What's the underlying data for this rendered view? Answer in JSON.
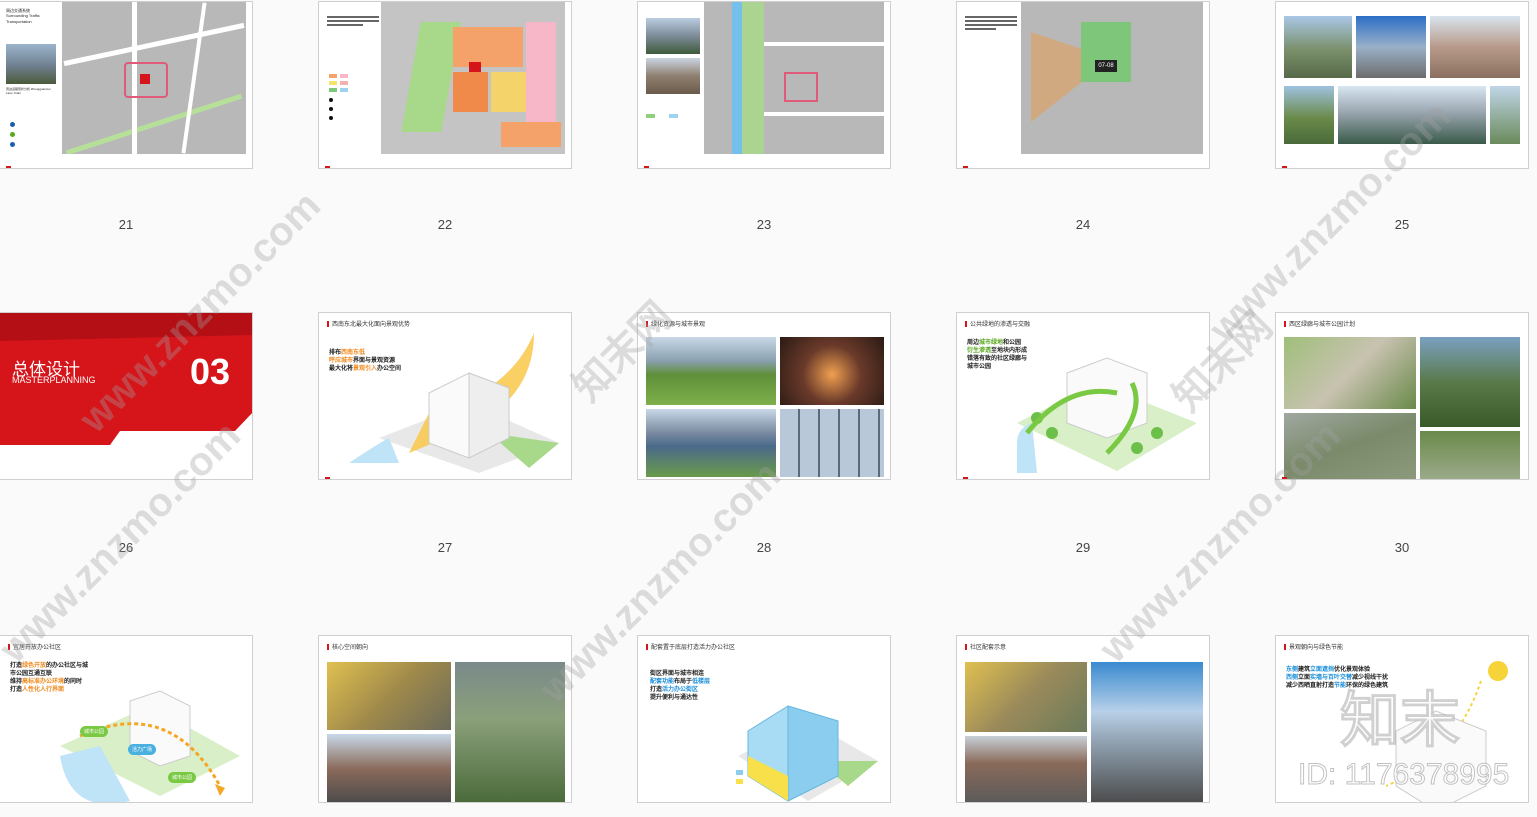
{
  "slides": [
    {
      "num": "21"
    },
    {
      "num": "22"
    },
    {
      "num": "23"
    },
    {
      "num": "24"
    },
    {
      "num": "25"
    },
    {
      "num": "26",
      "cn_title": "总体设计",
      "en_title": "MASTERPLANNING",
      "section": "03"
    },
    {
      "num": "27",
      "title": "西南东北最大化面向景观优势",
      "l1a": "排布",
      "l1b": "西南东低",
      "l2a": "",
      "l2b": "呼应城市",
      "l2c": "界面与景观资源",
      "l3a": "最大化将",
      "l3b": "景观引入",
      "l3c": "办公空间"
    },
    {
      "num": "28",
      "title": "绿化资源与城市景观"
    },
    {
      "num": "29",
      "title": "公共绿地的渗透与交融",
      "l1a": "周边",
      "l1b": "城市绿地",
      "l1c": "和公园",
      "l2a": "衍生渗透",
      "l2b": "至地块内形成",
      "l3": "错落有致的社区绿廊与",
      "l4": "城市公园"
    },
    {
      "num": "30",
      "title": "西区绿廊与城市公园计划"
    },
    {
      "num": "",
      "title": "宜居开放办公社区",
      "l1a": "打造",
      "l1b": "绿色开放",
      "l1c": "的办公社区与城",
      "l2": "市公园互通互联",
      "l3a": "维持",
      "l3b": "高标准办公环境",
      "l3c": "的同时",
      "l4a": "打造",
      "l4b": "人性化人行界面",
      "tag1": "城市公园",
      "tag2": "活力广场",
      "tag3": "城市公园"
    },
    {
      "num": "",
      "title": "核心空间朝向"
    },
    {
      "num": "",
      "title": "配套置于底层打造活力办公社区",
      "l1": "街区界面与城市相连",
      "l2a": "配套功能",
      "l2b": "布局于",
      "l2c": "低楼层",
      "l3a": "打造",
      "l3b": "活力办公街区",
      "l4": "提升便利与通达性"
    },
    {
      "num": "",
      "title": "社区配套示意"
    },
    {
      "num": "",
      "title": "景观朝向与绿色节能",
      "l1a": "东侧",
      "l1b": "建筑",
      "l1c": "立面遮挡",
      "l1d": "优化景观体验",
      "l2a": "西侧",
      "l2b": "立面",
      "l2c": "实墙与百叶交替",
      "l2d": "减少视线干扰",
      "l3a": "减少",
      "l3b": "西晒直射打造",
      "l3c": "节能",
      "l3d": "环保的绿色建筑"
    }
  ],
  "slide21": {
    "heading": "周边交通系统",
    "subheading": "Surrounding Traffic Transportation",
    "caption": "周边道路现状分析 Zhongguancun Lane Yulan"
  },
  "slide24": {
    "site_label": "07-08"
  },
  "watermark": {
    "text1": "www.znzmo.com",
    "text2": "知末网",
    "logo": "知末",
    "id": "ID: 1176378995"
  }
}
